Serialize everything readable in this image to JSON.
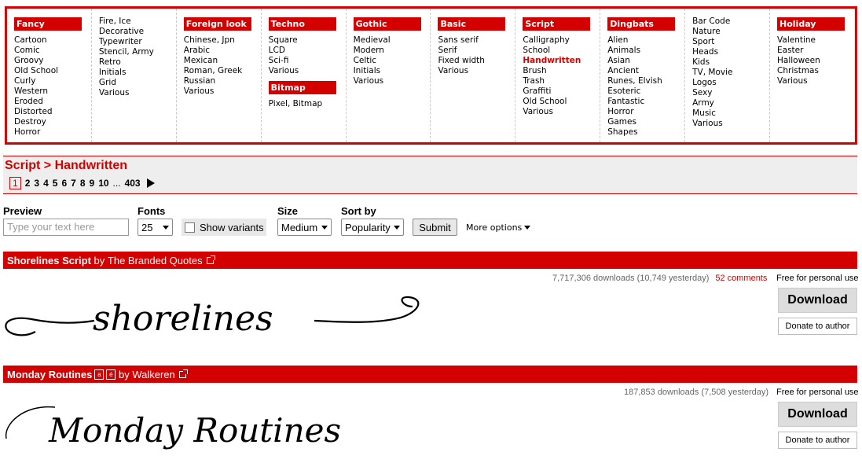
{
  "menu": {
    "fancy": {
      "title": "Fancy",
      "items": [
        "Cartoon",
        "Comic",
        "Groovy",
        "Old School",
        "Curly",
        "Western",
        "Eroded",
        "Distorted",
        "Destroy",
        "Horror"
      ]
    },
    "fancy2": {
      "items": [
        "Fire, Ice",
        "Decorative",
        "Typewriter",
        "Stencil, Army",
        "Retro",
        "Initials",
        "Grid",
        "Various"
      ]
    },
    "foreign": {
      "title": "Foreign look",
      "items": [
        "Chinese, Jpn",
        "Arabic",
        "Mexican",
        "Roman, Greek",
        "Russian",
        "Various"
      ]
    },
    "techno": {
      "title": "Techno",
      "items": [
        "Square",
        "LCD",
        "Sci-fi",
        "Various"
      ]
    },
    "bitmap": {
      "title": "Bitmap",
      "items": [
        "Pixel, Bitmap"
      ]
    },
    "gothic": {
      "title": "Gothic",
      "items": [
        "Medieval",
        "Modern",
        "Celtic",
        "Initials",
        "Various"
      ]
    },
    "basic": {
      "title": "Basic",
      "items": [
        "Sans serif",
        "Serif",
        "Fixed width",
        "Various"
      ]
    },
    "script": {
      "title": "Script",
      "items": [
        "Calligraphy",
        "School",
        "Handwritten",
        "Brush",
        "Trash",
        "Graffiti",
        "Old School",
        "Various"
      ]
    },
    "dingbats": {
      "title": "Dingbats",
      "items": [
        "Alien",
        "Animals",
        "Asian",
        "Ancient",
        "Runes, Elvish",
        "Esoteric",
        "Fantastic",
        "Horror",
        "Games",
        "Shapes"
      ]
    },
    "dingbats2": {
      "items": [
        "Bar Code",
        "Nature",
        "Sport",
        "Heads",
        "Kids",
        "TV, Movie",
        "Logos",
        "Sexy",
        "Army",
        "Music",
        "Various"
      ]
    },
    "holiday": {
      "title": "Holiday",
      "items": [
        "Valentine",
        "Easter",
        "Halloween",
        "Christmas",
        "Various"
      ]
    }
  },
  "breadcrumb": "Script > Handwritten",
  "pager": {
    "current": "1",
    "pages": [
      "2",
      "3",
      "4",
      "5",
      "6",
      "7",
      "8",
      "9",
      "10"
    ],
    "dots": "...",
    "last": "403"
  },
  "filters": {
    "preview_label": "Preview",
    "preview_placeholder": "Type your text here",
    "fonts_label": "Fonts",
    "fonts_value": "25",
    "variants_label": "Show variants",
    "size_label": "Size",
    "size_value": "Medium",
    "sort_label": "Sort by",
    "sort_value": "Popularity",
    "submit": "Submit",
    "more": "More options"
  },
  "fonts": [
    {
      "name": "Shorelines Script",
      "by": "by",
      "author": "The Branded Quotes",
      "downloads": "7,717,306 downloads (10,749 yesterday)",
      "comments": "52 comments",
      "license": "Free for personal use",
      "download": "Download",
      "donate": "Donate to author",
      "preview_text": "shorelines"
    },
    {
      "name": "Monday Routines",
      "badge1": "a",
      "badge2": "é",
      "by": "by",
      "author": "Walkeren",
      "downloads": "187,853 downloads (7,508 yesterday)",
      "license": "Free for personal use",
      "download": "Download",
      "donate": "Donate to author",
      "preview_text": "Monday Routines"
    }
  ],
  "colors": {
    "accent": "#d40000"
  }
}
